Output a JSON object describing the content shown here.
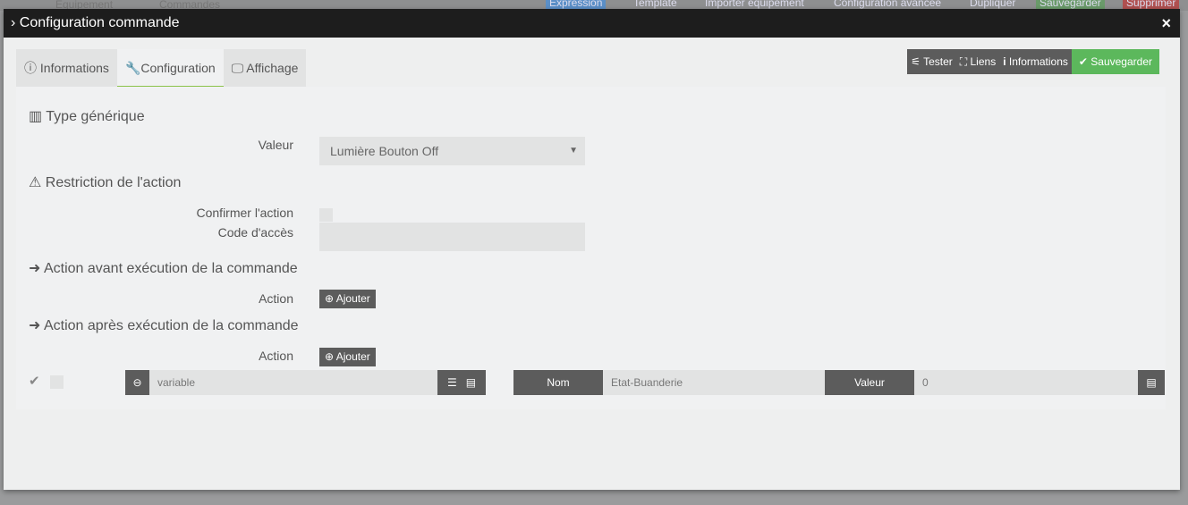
{
  "background": {
    "tabs": [
      "Equipement",
      "Commandes"
    ],
    "buttons": [
      "Expression",
      "Template",
      "Importer équipement",
      "Configuration avancée",
      "Dupliquer",
      "Sauvegarder",
      "Supprimer"
    ]
  },
  "modal": {
    "title": "Configuration commande",
    "close": "×"
  },
  "tabs": [
    "Informations",
    "Configuration",
    "Affichage"
  ],
  "toolbar": {
    "test": "Tester",
    "links": "Liens",
    "info": "Informations",
    "save": "Sauvegarder"
  },
  "generic": {
    "heading": "Type générique",
    "value_label": "Valeur",
    "value": "Lumière Bouton Off"
  },
  "restriction": {
    "heading": "Restriction de l'action",
    "confirm_label": "Confirmer l'action",
    "code_label": "Code d'accès"
  },
  "before": {
    "heading": "Action avant exécution de la commande",
    "action_label": "Action",
    "add": "Ajouter"
  },
  "after": {
    "heading": "Action après exécution de la commande",
    "action_label": "Action",
    "add": "Ajouter",
    "row": {
      "command": "variable",
      "name_label": "Nom",
      "name": "Etat-Buanderie",
      "value_label": "Valeur",
      "value": "0"
    }
  }
}
